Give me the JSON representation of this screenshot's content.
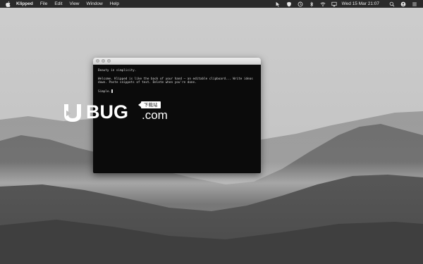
{
  "menubar": {
    "app_name": "Klipped",
    "menus": [
      "File",
      "Edit",
      "View",
      "Window",
      "Help"
    ],
    "clock": "Wed 15 Mar  21:07"
  },
  "window": {
    "lines": [
      "Beauty in simplicity.",
      "Welcome. Klipped is like the back of your hand — an editable clipboard... Write ideas down. Paste snippets of text. Delete when you're done.",
      "Simple."
    ]
  },
  "watermark": {
    "brand": "BUG",
    "domain": ".com",
    "badge": "下载站"
  },
  "colors": {
    "menubar": "#1c1c1c",
    "editor_bg": "#0b0b0b",
    "editor_text": "#d8d8d8"
  }
}
